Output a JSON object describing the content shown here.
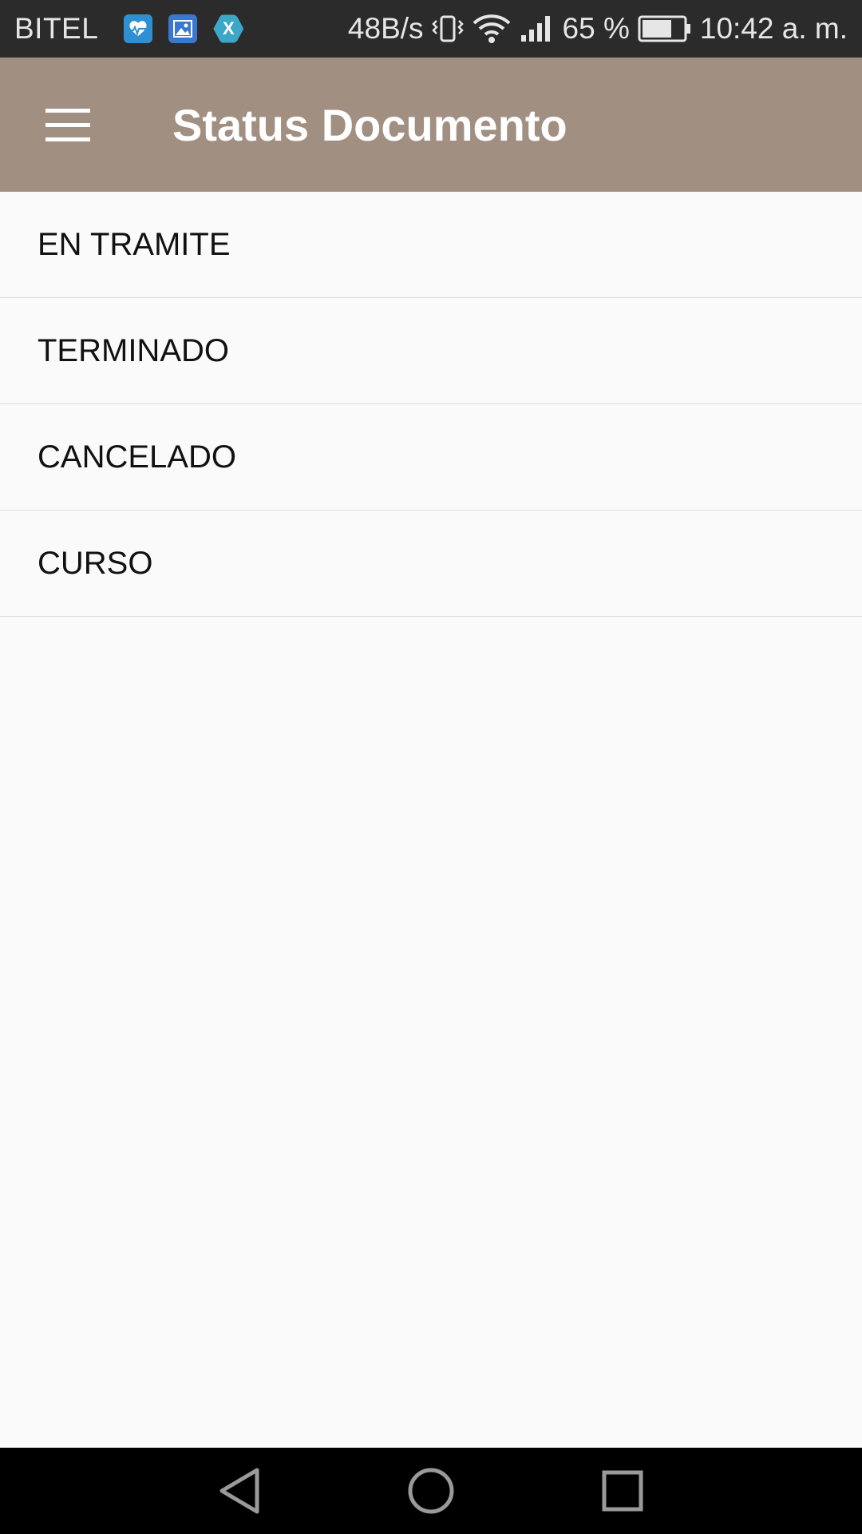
{
  "status_bar": {
    "carrier": "BITEL",
    "notifications": [
      "health-app-icon",
      "gallery-icon",
      "xamarin-icon"
    ],
    "x_app_glyph": "X",
    "net_speed": "48B/s",
    "battery_percent": "65 %",
    "time": "10:42 a. m."
  },
  "app_bar": {
    "title": "Status Documento",
    "background_color": "#a18f82",
    "menu_icon": "hamburger-icon"
  },
  "list": {
    "items": [
      {
        "label": "EN TRAMITE"
      },
      {
        "label": "TERMINADO"
      },
      {
        "label": "CANCELADO"
      },
      {
        "label": "CURSO"
      }
    ]
  },
  "nav_bar": {
    "buttons": [
      "back-icon",
      "home-icon",
      "recents-icon"
    ]
  }
}
